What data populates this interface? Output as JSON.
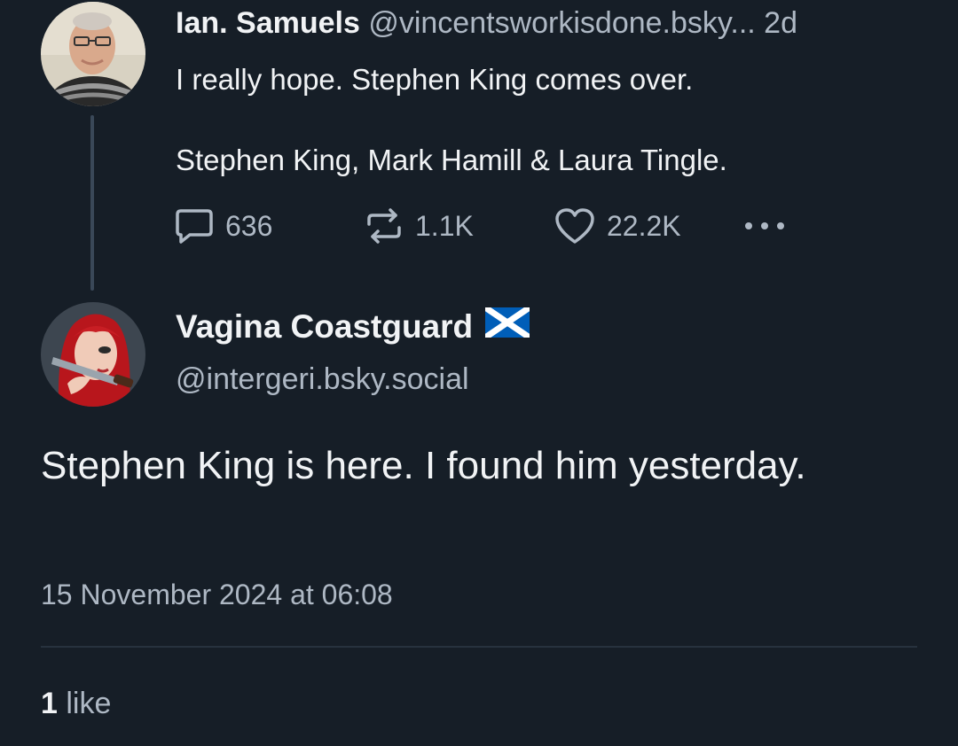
{
  "parent_post": {
    "author_name": "Ian. Samuels",
    "author_handle": "@vincentsworkisdone.bsky...",
    "time_ago": "2d",
    "text_line1": "I really hope. Stephen King comes over.",
    "text_line2": "Stephen King, Mark Hamill & Laura Tingle.",
    "reply_count": "636",
    "repost_count": "1.1K",
    "like_count": "22.2K",
    "avatar_icon": "person-photo-avatar",
    "reply_icon": "speech-bubble-icon",
    "repost_icon": "repost-arrows-icon",
    "like_icon": "heart-icon",
    "more_icon": "ellipsis-icon"
  },
  "main_post": {
    "author_name": "Vagina Coastguard",
    "author_flag": "scotland-flag-icon",
    "author_handle": "@intergeri.bsky.social",
    "text": "Stephen King is here.  I found him yesterday.",
    "timestamp": "15 November 2024 at 06:08",
    "like_count": "1",
    "like_label": " like",
    "avatar_icon": "cartoon-avatar"
  },
  "colors": {
    "background": "#161e27",
    "text_primary": "#f1f3f5",
    "text_secondary": "#aeb8c4",
    "thread_line": "#3a4858",
    "divider": "#27323e",
    "flag_blue": "#005eb8"
  }
}
